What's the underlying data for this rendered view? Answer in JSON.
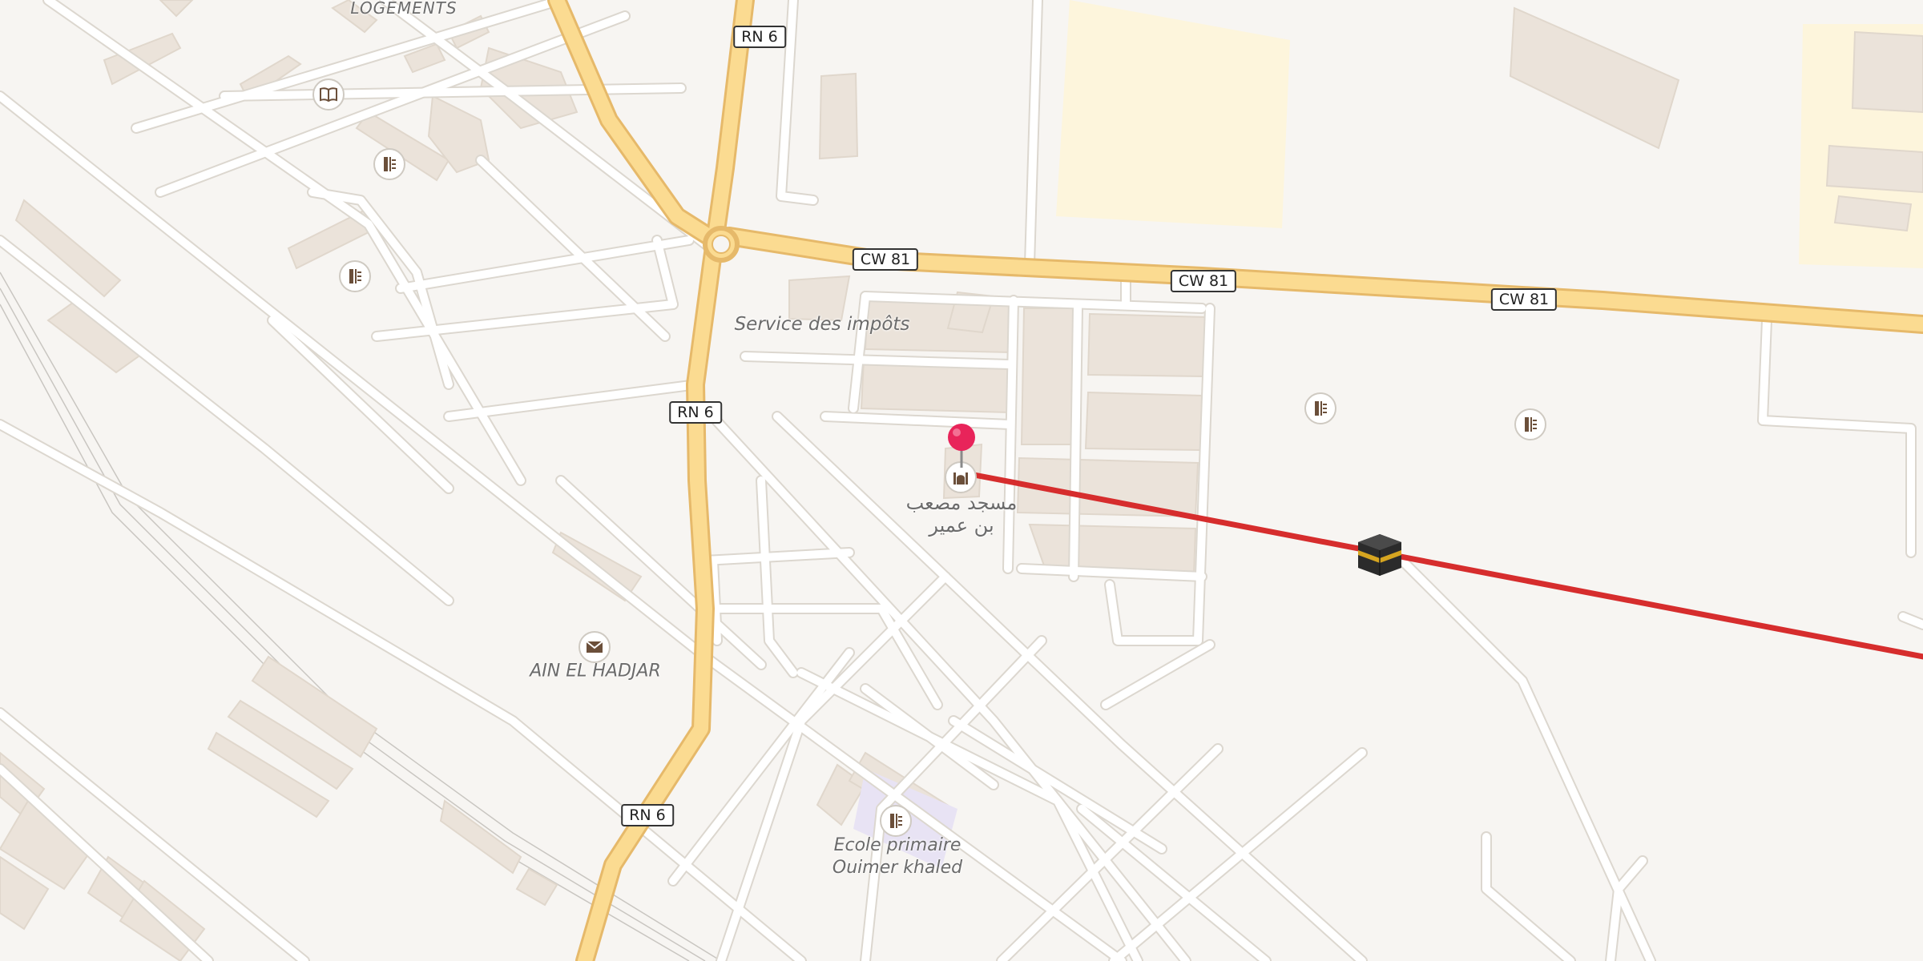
{
  "map": {
    "place_labels": [
      {
        "id": "logements",
        "text": "LOGEMENTS"
      },
      {
        "id": "impots",
        "text": "Service des impôts"
      },
      {
        "id": "mosque",
        "text": "مسجد مصعب\nبن عمير"
      },
      {
        "id": "ain_el_hadjar",
        "text": "AIN EL HADJAR"
      },
      {
        "id": "ecole",
        "text": "Ecole primaire\nOuimer khaled"
      }
    ],
    "road_shields": [
      {
        "id": "rn6_a",
        "text": "RN 6"
      },
      {
        "id": "rn6_b",
        "text": "RN 6"
      },
      {
        "id": "rn6_c",
        "text": "RN 6"
      },
      {
        "id": "cw81_a",
        "text": "CW 81"
      },
      {
        "id": "cw81_b",
        "text": "CW 81"
      },
      {
        "id": "cw81_c",
        "text": "CW 81"
      }
    ],
    "pois": [
      {
        "id": "library",
        "icon": "book-icon"
      },
      {
        "id": "school1",
        "icon": "school-icon"
      },
      {
        "id": "school2",
        "icon": "school-icon"
      },
      {
        "id": "school3",
        "icon": "school-icon"
      },
      {
        "id": "school4",
        "icon": "school-icon"
      },
      {
        "id": "school5",
        "icon": "school-icon"
      },
      {
        "id": "post",
        "icon": "mail-icon"
      },
      {
        "id": "mosque",
        "icon": "mosque-icon"
      }
    ],
    "qibla_line_color": "#d62d2d",
    "pin_color": "#e8245a",
    "kaaba_icon": "kaaba-icon",
    "road_major_color": "#f9d98c",
    "road_minor_color": "#ffffff",
    "building_color": "#ebe3da",
    "landuse_color": "#fdf5dc"
  }
}
